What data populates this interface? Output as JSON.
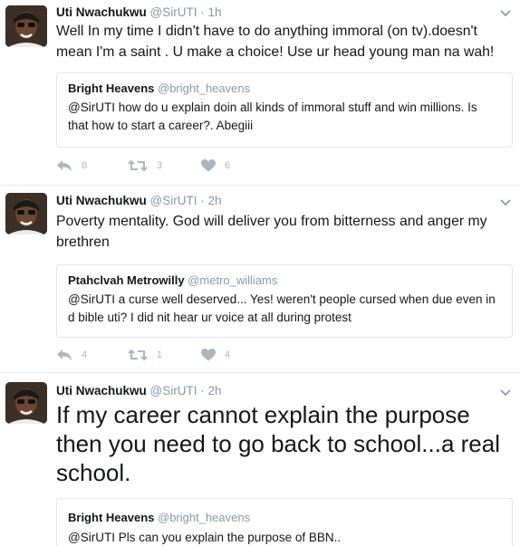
{
  "tweets": [
    {
      "name": "Uti Nwachukwu",
      "handle": "@SirUTI",
      "dot": "·",
      "time": "1h",
      "text": "Well In my time I didn't have to do anything immoral (on tv).doesn't mean I'm a saint . U make a choice! Use ur head young man  na wah!",
      "quote": {
        "name": "Bright Heavens",
        "handle": "@bright_heavens",
        "text": "@SirUTI how do u explain doin all kinds of immoral stuff and win millions. Is that how to start a career?. Abegiii"
      },
      "replies": "8",
      "retweets": "3",
      "likes": "6"
    },
    {
      "name": "Uti Nwachukwu",
      "handle": "@SirUTI",
      "dot": "·",
      "time": "2h",
      "text": "Poverty mentality. God will deliver you from bitterness and anger my brethren",
      "quote": {
        "name": "Ptahclvah Metrowilly",
        "handle": "@metro_williams",
        "text": "@SirUTI a curse well deserved... Yes!  weren't people cursed when due even in d bible uti? I did nit hear ur voice at all during protest"
      },
      "replies": "4",
      "retweets": "1",
      "likes": "4"
    },
    {
      "name": "Uti Nwachukwu",
      "handle": "@SirUTI",
      "dot": "·",
      "time": "2h",
      "text": "If my career cannot explain the purpose then you need to go back to school...a real school.",
      "quote": {
        "name": "Bright Heavens",
        "handle": "@bright_heavens",
        "text": "@SirUTI Pls can you explain the purpose of BBN.."
      }
    }
  ],
  "icons": {
    "reply": "reply-icon",
    "retweet": "retweet-icon",
    "like": "heart-icon",
    "more": "chevron-down-icon"
  },
  "colors": {
    "secondary_text": "#8899a6",
    "action_icons": "#aab8c2",
    "border": "#e1e8ed"
  }
}
